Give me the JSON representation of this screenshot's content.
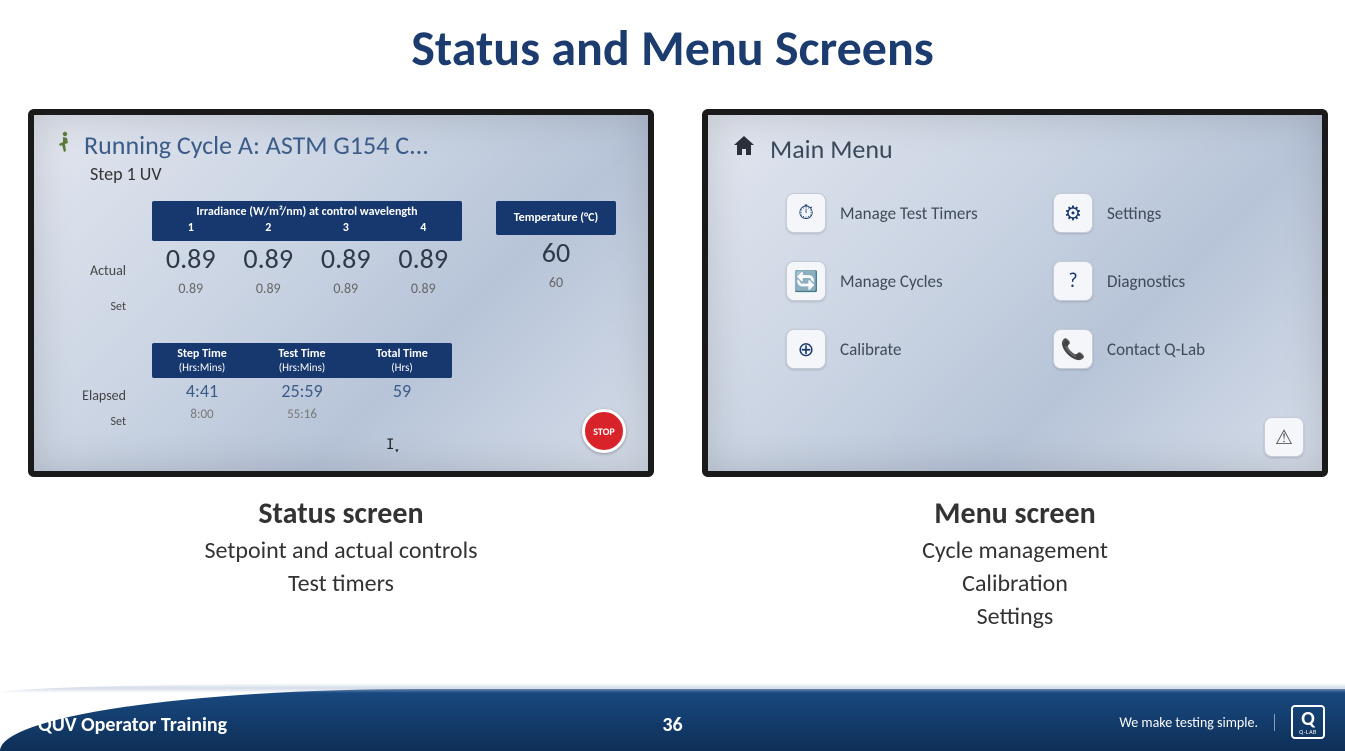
{
  "title": "Status and Menu Screens",
  "status": {
    "running_line": "Running Cycle A: ASTM G154 C...",
    "step_line": "Step 1 UV",
    "irr": {
      "header_title": "Irradiance (W/m²/nm) at control wavelength",
      "cols": [
        "1",
        "2",
        "3",
        "4"
      ],
      "row_actual_label": "Actual",
      "row_set_label": "Set",
      "actual": [
        "0.89",
        "0.89",
        "0.89",
        "0.89"
      ],
      "set": [
        "0.89",
        "0.89",
        "0.89",
        "0.89"
      ]
    },
    "temp": {
      "header_title": "Temperature (°C)",
      "actual": "60",
      "set": "60"
    },
    "time": {
      "row_elapsed_label": "Elapsed",
      "row_set_label": "Set",
      "cols": [
        {
          "title": "Step Time",
          "sub": "(Hrs:Mins)",
          "elapsed": "4:41",
          "set": "8:00"
        },
        {
          "title": "Test Time",
          "sub": "(Hrs:Mins)",
          "elapsed": "25:59",
          "set": "55:16"
        },
        {
          "title": "Total Time",
          "sub": "(Hrs)",
          "elapsed": "59",
          "set": ""
        }
      ]
    },
    "stop_label": "STOP"
  },
  "menu": {
    "title": "Main Menu",
    "items": [
      {
        "icon": "⏱",
        "label": "Manage Test Timers"
      },
      {
        "icon": "⚙",
        "label": "Settings"
      },
      {
        "icon": "🔄",
        "label": "Manage Cycles"
      },
      {
        "icon": "?",
        "label": "Diagnostics"
      },
      {
        "icon": "⊕",
        "label": "Calibrate"
      },
      {
        "icon": "📞",
        "label": "Contact Q-Lab"
      }
    ],
    "warn_icon": "⚠"
  },
  "captions": {
    "left": {
      "title": "Status screen",
      "lines": [
        "Setpoint and actual controls",
        "Test timers"
      ]
    },
    "right": {
      "title": "Menu screen",
      "lines": [
        "Cycle management",
        "Calibration",
        "Settings"
      ]
    }
  },
  "footer": {
    "left": "QUV Operator Training",
    "page": "36",
    "tagline": "We make testing simple.",
    "logo_letter": "Q",
    "logo_sub": "Q-LAB"
  }
}
